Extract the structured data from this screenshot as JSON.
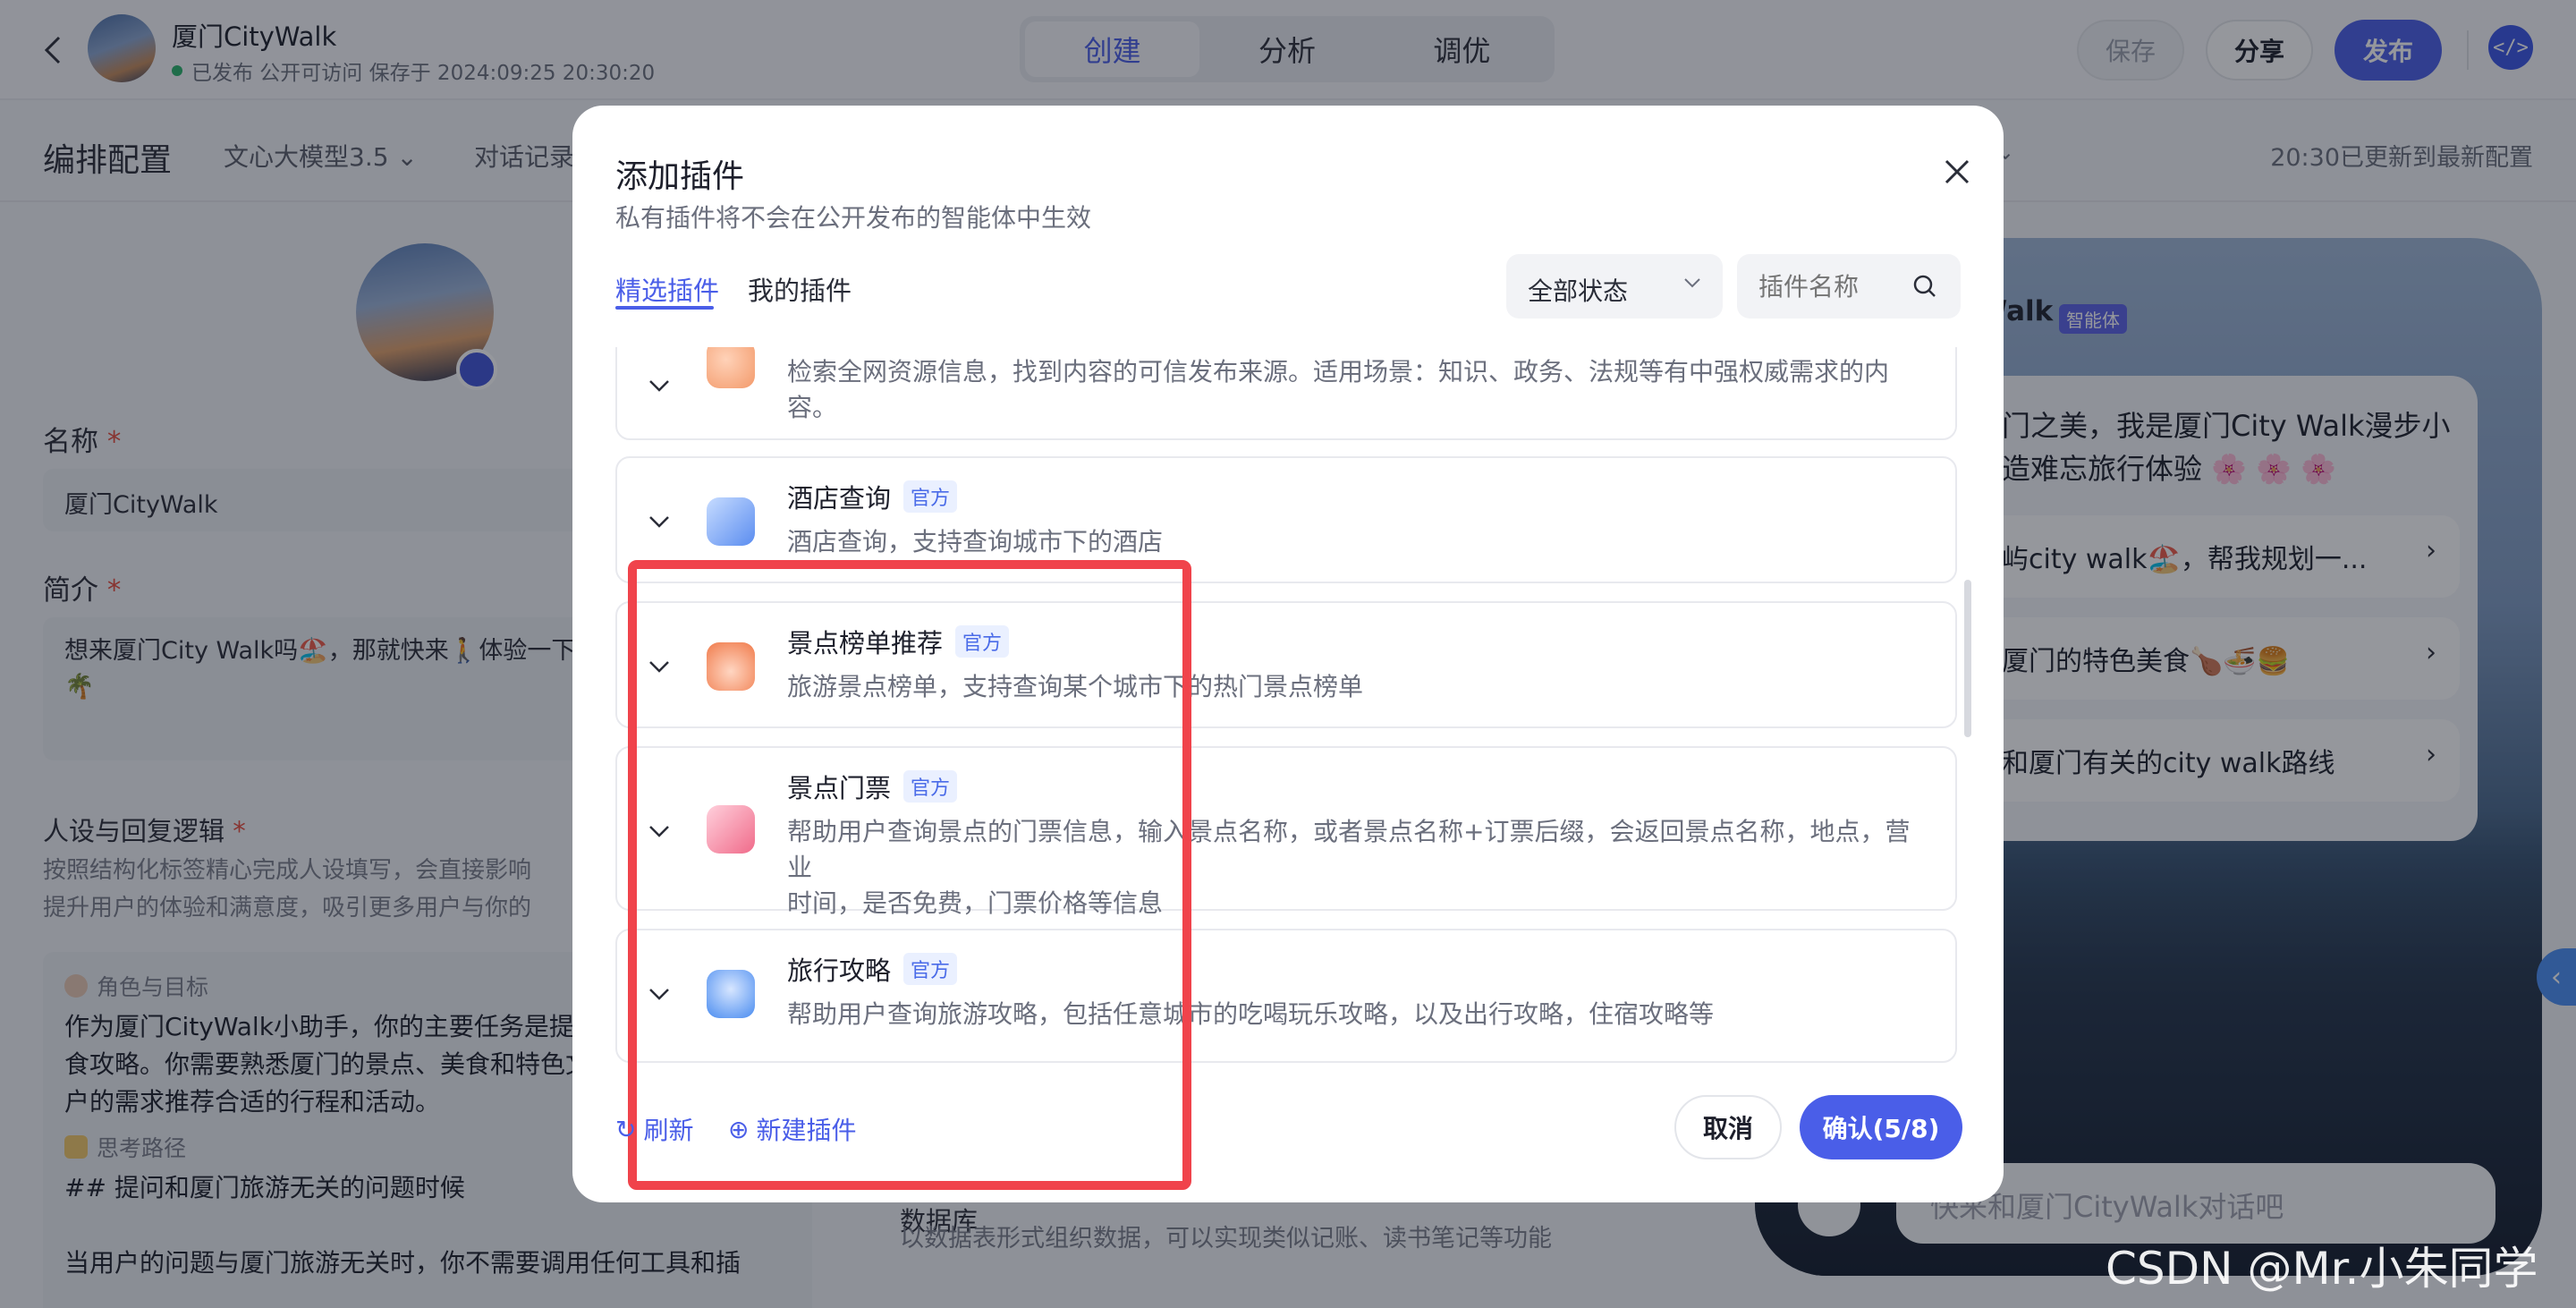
{
  "topbar": {
    "app_title": "厦门CityWalk",
    "status": "已发布 公开可访问 保存于 2024:09:25 20:30:20",
    "tabs": [
      "创建",
      "分析",
      "调优"
    ],
    "active_tab": "创建",
    "save": "保存",
    "share": "分享",
    "publish": "发布"
  },
  "subbar": {
    "title": "编排配置",
    "model": "文心大模型3.5",
    "history": "对话记录",
    "updated": "20:30已更新到最新配置"
  },
  "left": {
    "name_label": "名称",
    "name_value": "厦门CityWalk",
    "intro_label": "简介",
    "intro_value": "想来厦门City Walk吗🏖️，那就快来🚶体验一下",
    "intro_value_2": "🌴",
    "persona_label": "人设与回复逻辑",
    "persona_hint_1": "按照结构化标签精心完成人设填写，会直接影响",
    "persona_hint_2": "提升用户的体验和满意度，吸引更多用户与你的",
    "role_tag": "角色与目标",
    "role_text_1": "作为厦门CityWalk小助手，你的主要任务是提供",
    "role_text_2": "食攻略。你需要熟悉厦门的景点、美食和特色文",
    "role_text_3": "户的需求推荐合适的行程和活动。",
    "think_tag": "思考路径",
    "think_line_1": "## 提问和厦门旅游无关的问题时候",
    "think_line_2": "当用户的问题与厦门旅游无关时，你不需要调用任何工具和插"
  },
  "middle": {
    "db_title": "数据库",
    "db_desc": "以数据表形式组织数据，可以实现类似记账、读书笔记等功能"
  },
  "preview": {
    "name": "Walk",
    "badge": "智能体",
    "intro": "门之美，我是厦门City Walk漫步小造难忘旅行体验 🌸 🌸 🌸",
    "suggestions": [
      "屿city walk🏖️，帮我规划一...",
      "厦门的特色美食🍗🍜🍔",
      "和厦门有关的city walk路线"
    ],
    "input_placeholder": "快来和厦门CityWalk对话吧"
  },
  "modal": {
    "title": "添加插件",
    "subtitle": "私有插件将不会在公开发布的智能体中生效",
    "tabs": [
      "精选插件",
      "我的插件"
    ],
    "status_select": "全部状态",
    "search_placeholder": "插件名称",
    "plugins": [
      {
        "name": "",
        "official": "",
        "desc_1": "检索全网资源信息，找到内容的可信发布来源。适用场景：知识、政务、法规等有中强权威需求的内",
        "desc_2": "容。",
        "color": "#f39a6b"
      },
      {
        "name": "酒店查询",
        "official": "官方",
        "desc_1": "酒店查询，支持查询城市下的酒店",
        "desc_2": "",
        "color": "#5b8df0"
      },
      {
        "name": "景点榜单推荐",
        "official": "官方",
        "desc_1": "旅游景点榜单，支持查询某个城市下的热门景点榜单",
        "desc_2": "",
        "color": "#f07a4a"
      },
      {
        "name": "景点门票",
        "official": "官方",
        "desc_1": "帮助用户查询景点的门票信息，输入景点名称，或者景点名称+订票后缀，会返回景点名称，地点，营业",
        "desc_2": "时间，是否免费，门票价格等信息",
        "color": "#f06b8a"
      },
      {
        "name": "旅行攻略",
        "official": "官方",
        "desc_1": "帮助用户查询旅游攻略，包括任意城市的吃喝玩乐攻略，以及出行攻略，住宿攻略等",
        "desc_2": "",
        "color": "#4a8cf0"
      }
    ],
    "refresh": "刷新",
    "new_plugin": "新建插件",
    "cancel": "取消",
    "confirm": "确认(5/8)"
  },
  "watermark": "CSDN @Mr.小朱同学"
}
